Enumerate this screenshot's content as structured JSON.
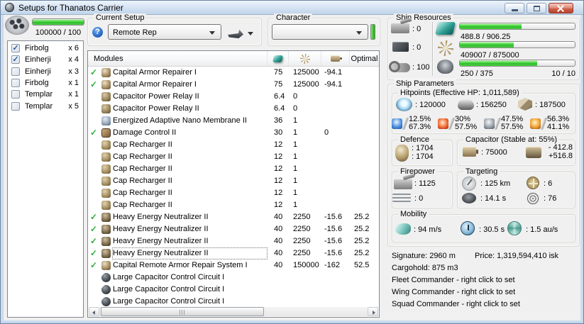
{
  "window": {
    "title": "Setups for Thanatos Carrier"
  },
  "glyphs": {
    "check": "✓",
    "help": "?"
  },
  "colors": {
    "bar_green": "#3ec32e",
    "check_green": "#2fae3a",
    "close_red": "#cd5a44"
  },
  "drone_bay": {
    "bandwidth_text": "100000 / 100",
    "bar_pct": 100,
    "items": [
      {
        "checked": true,
        "name": "Firbolg",
        "qty": "x 6"
      },
      {
        "checked": true,
        "name": "Einherji",
        "qty": "x 4"
      },
      {
        "checked": false,
        "name": "Einherji",
        "qty": "x 3"
      },
      {
        "checked": false,
        "name": "Firbolg",
        "qty": "x 1"
      },
      {
        "checked": false,
        "name": "Templar",
        "qty": "x 1"
      },
      {
        "checked": false,
        "name": "Templar",
        "qty": "x 5"
      }
    ]
  },
  "current_setup": {
    "label": "Current Setup",
    "selected": "Remote Rep"
  },
  "character": {
    "label": "Character",
    "selected": ""
  },
  "modules": {
    "title": "Modules",
    "optimal_header": "Optimal",
    "rows": [
      {
        "active": true,
        "icon": "repairer",
        "name": "Capital Armor Repairer I",
        "cpu": "75",
        "pg": "125000",
        "cap": "-94.1",
        "optimal": ""
      },
      {
        "active": true,
        "icon": "repairer",
        "name": "Capital Armor Repairer I",
        "cpu": "75",
        "pg": "125000",
        "cap": "-94.1",
        "optimal": ""
      },
      {
        "active": false,
        "icon": "relay",
        "name": "Capacitor Power Relay II",
        "cpu": "6.4",
        "pg": "0",
        "cap": "",
        "optimal": ""
      },
      {
        "active": false,
        "icon": "relay",
        "name": "Capacitor Power Relay II",
        "cpu": "6.4",
        "pg": "0",
        "cap": "",
        "optimal": ""
      },
      {
        "active": false,
        "icon": "membrane",
        "name": "Energized Adaptive Nano Membrane II",
        "cpu": "36",
        "pg": "1",
        "cap": "",
        "optimal": ""
      },
      {
        "active": true,
        "icon": "damage-control",
        "name": "Damage Control II",
        "cpu": "30",
        "pg": "1",
        "cap": "0",
        "optimal": ""
      },
      {
        "active": false,
        "icon": "recharger",
        "name": "Cap Recharger II",
        "cpu": "12",
        "pg": "1",
        "cap": "",
        "optimal": ""
      },
      {
        "active": false,
        "icon": "recharger",
        "name": "Cap Recharger II",
        "cpu": "12",
        "pg": "1",
        "cap": "",
        "optimal": ""
      },
      {
        "active": false,
        "icon": "recharger",
        "name": "Cap Recharger II",
        "cpu": "12",
        "pg": "1",
        "cap": "",
        "optimal": ""
      },
      {
        "active": false,
        "icon": "recharger",
        "name": "Cap Recharger II",
        "cpu": "12",
        "pg": "1",
        "cap": "",
        "optimal": ""
      },
      {
        "active": false,
        "icon": "recharger",
        "name": "Cap Recharger II",
        "cpu": "12",
        "pg": "1",
        "cap": "",
        "optimal": ""
      },
      {
        "active": false,
        "icon": "recharger",
        "name": "Cap Recharger II",
        "cpu": "12",
        "pg": "1",
        "cap": "",
        "optimal": ""
      },
      {
        "active": true,
        "icon": "neutralizer",
        "name": "Heavy Energy Neutralizer II",
        "cpu": "40",
        "pg": "2250",
        "cap": "-15.6",
        "optimal": "25.2"
      },
      {
        "active": true,
        "icon": "neutralizer",
        "name": "Heavy Energy Neutralizer II",
        "cpu": "40",
        "pg": "2250",
        "cap": "-15.6",
        "optimal": "25.2"
      },
      {
        "active": true,
        "icon": "neutralizer",
        "name": "Heavy Energy Neutralizer II",
        "cpu": "40",
        "pg": "2250",
        "cap": "-15.6",
        "optimal": "25.2"
      },
      {
        "active": true,
        "icon": "neutralizer",
        "name": "Heavy Energy Neutralizer II",
        "cpu": "40",
        "pg": "2250",
        "cap": "-15.6",
        "optimal": "25.2",
        "focused": true
      },
      {
        "active": true,
        "icon": "remote-repairer",
        "name": "Capital Remote Armor Repair System I",
        "cpu": "40",
        "pg": "150000",
        "cap": "-162",
        "optimal": "52.5"
      },
      {
        "active": false,
        "icon": "rig",
        "name": "Large Capacitor Control Circuit I",
        "cpu": "",
        "pg": "",
        "cap": "",
        "optimal": ""
      },
      {
        "active": false,
        "icon": "rig",
        "name": "Large Capacitor Control Circuit I",
        "cpu": "",
        "pg": "",
        "cap": "",
        "optimal": ""
      },
      {
        "active": false,
        "icon": "rig",
        "name": "Large Capacitor Control Circuit I",
        "cpu": "",
        "pg": "",
        "cap": "",
        "optimal": ""
      }
    ]
  },
  "ship_resources": {
    "label": "Ship Resources",
    "turrets": ": 0",
    "launchers": ": 0",
    "calibration": ": 100",
    "cpu": {
      "text": "488.8 / 906.25",
      "pct": 54
    },
    "powergrid": {
      "text": "409007 / 875000",
      "pct": 47
    },
    "drones": {
      "text": "250 / 375",
      "right": "10 / 10",
      "pct": 67
    }
  },
  "ship_parameters": {
    "label": "Ship Parameters",
    "hitpoints": {
      "label": "Hitpoints (Effective HP: 1,011,589)",
      "shield": ": 120000",
      "armor": ": 156250",
      "structure": ": 187500",
      "resists": [
        {
          "type": "em",
          "shield": "12.5%",
          "armor": "67.3%"
        },
        {
          "type": "thermal",
          "shield": "30%",
          "armor": "57.5%"
        },
        {
          "type": "kinetic",
          "shield": "47.5%",
          "armor": "57.5%"
        },
        {
          "type": "explosive",
          "shield": "56.3%",
          "armor": "41.1%"
        }
      ]
    },
    "defence": {
      "label": "Defence",
      "tank1": ": 1704",
      "tank2": ": 1704"
    },
    "capacitor": {
      "label": "Capacitor (Stable at: 55%)",
      "amount": ": 75000",
      "drain": "- 412.8",
      "recharge": "+516.8"
    },
    "firepower": {
      "label": "Firepower",
      "turret": ": 1125",
      "missile": ": 0"
    },
    "targeting": {
      "label": "Targeting",
      "range": ": 125 km",
      "lock_time": ": 14.1 s",
      "max_targets": ": 6",
      "sensor_strength": ": 76"
    },
    "mobility": {
      "label": "Mobility",
      "speed": ": 94 m/s",
      "align_time": ": 30.5 s",
      "warp_speed": ": 1.5 au/s"
    }
  },
  "footer": {
    "signature": "Signature: 2960 m",
    "price": "Price: 1,319,594,410 isk",
    "cargohold": "Cargohold: 875 m3",
    "fleet": "Fleet Commander - right click to set",
    "wing": "Wing Commander - right click to set",
    "squad": "Squad Commander - right click to set"
  }
}
